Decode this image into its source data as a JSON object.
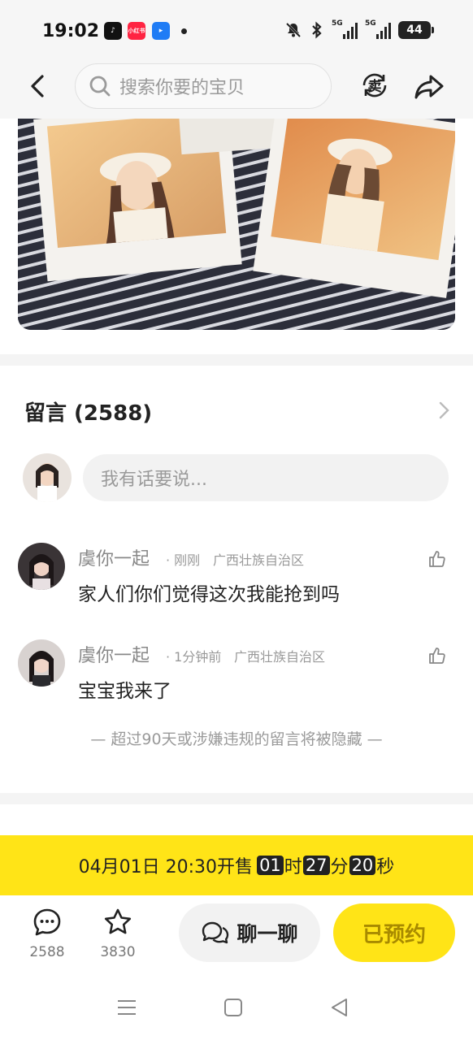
{
  "status_bar": {
    "time": "19:02",
    "apps": [
      "tiktok-icon",
      "xiaohongshu-icon",
      "lark-icon"
    ],
    "xhs_label": "小红书",
    "network_1": "5G",
    "network_2": "5G",
    "battery": "44"
  },
  "nav": {
    "search_placeholder": "搜索你要的宝贝",
    "sell_label": "卖"
  },
  "comments": {
    "title": "留言 (2588)",
    "input_placeholder": "我有话要说...",
    "items": [
      {
        "name": "虞你一起",
        "time": "· 刚刚",
        "location": "广西壮族自治区",
        "text": "家人们你们觉得这次我能抢到吗"
      },
      {
        "name": "虞你一起",
        "time": "· 1分钟前",
        "location": "广西壮族自治区",
        "text": "宝宝我来了"
      }
    ],
    "notice": "— 超过90天或涉嫌违规的留言将被隐藏 —"
  },
  "banner": {
    "prefix": "04月01日 20:30开售",
    "hours": "01",
    "hours_unit": "时",
    "minutes": "27",
    "minutes_unit": "分",
    "seconds": "20",
    "seconds_unit": "秒"
  },
  "bottom_bar": {
    "comment_count": "2588",
    "favorite_count": "3830",
    "chat_label": "聊一聊",
    "reserved_label": "已预约"
  },
  "colors": {
    "accent_yellow": "#ffe417",
    "reserved_text": "#a88a00"
  }
}
